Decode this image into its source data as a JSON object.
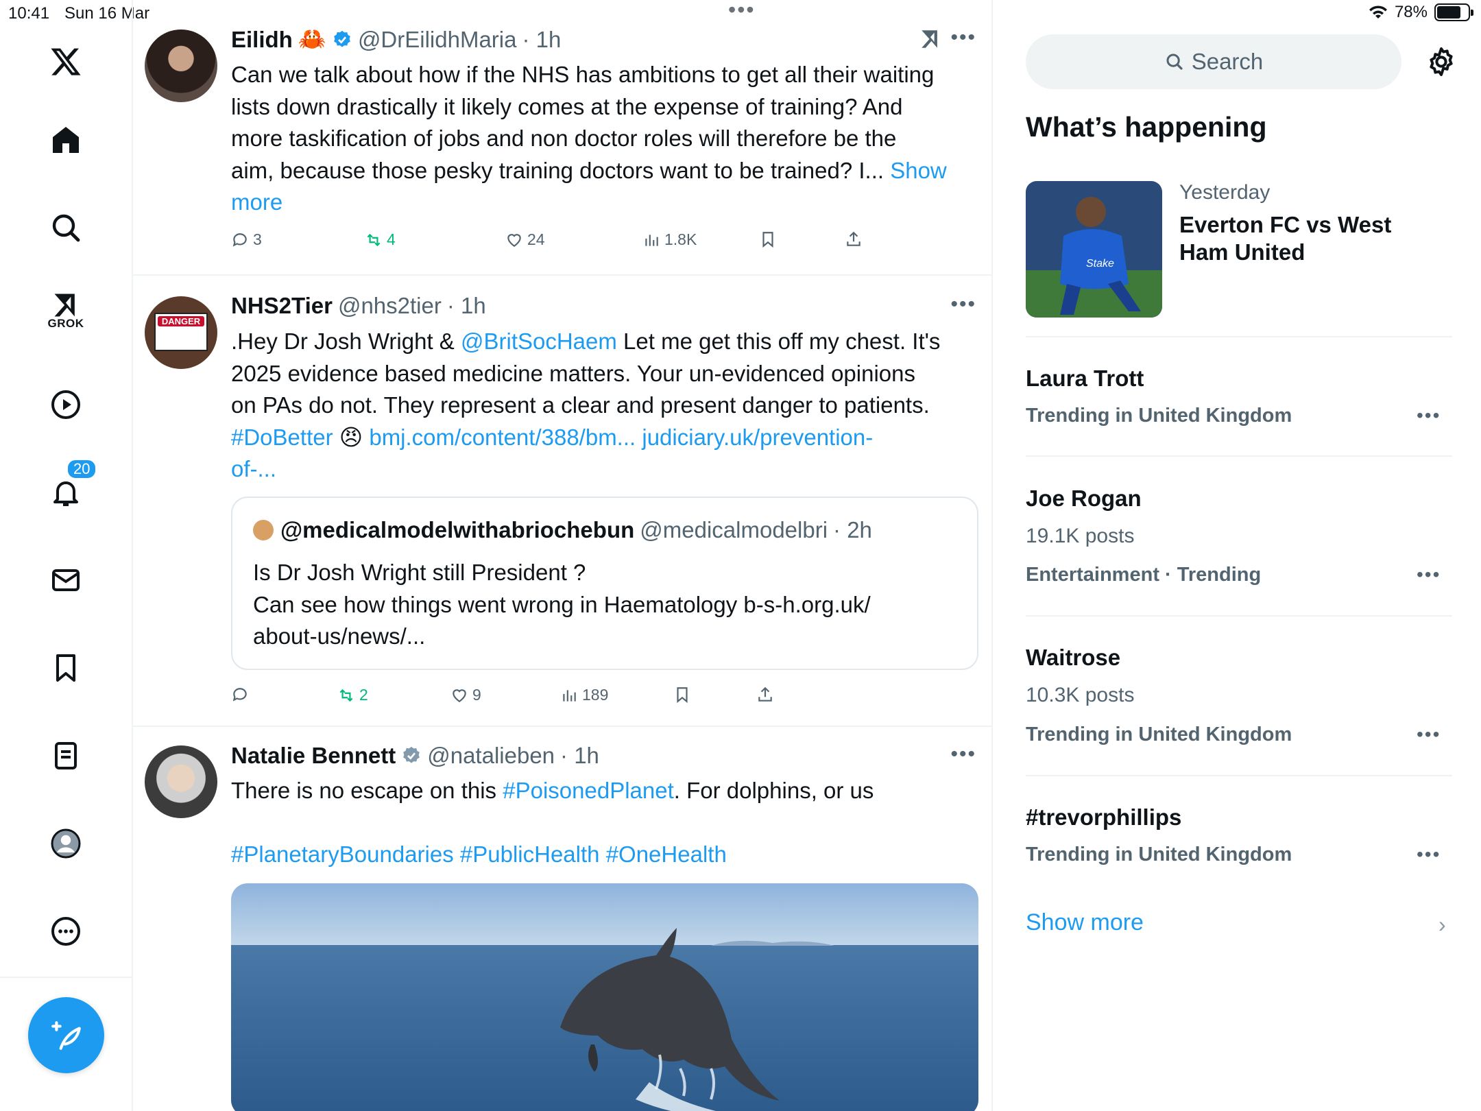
{
  "status_bar": {
    "time": "10:41",
    "date": "Sun 16 Mar",
    "battery": "78%",
    "battery_level": 0.78
  },
  "nav": {
    "notifications_badge": "20",
    "grok_label": "GROK",
    "items": [
      "x-logo",
      "home",
      "explore",
      "grok",
      "videos",
      "notifications",
      "messages",
      "bookmarks",
      "lists",
      "profile",
      "more"
    ]
  },
  "feed": {
    "tweets": [
      {
        "name": "Eilidh",
        "emoji": "🦀",
        "verified": true,
        "handle": "@DrEilidhMaria",
        "time": "· 1h",
        "body_lines": [
          "Can we talk about how if the NHS has ambitions to get all their waiting",
          "lists down drastically it likely comes at the expense of training? And",
          "more taskification of jobs and non doctor roles will therefore be the",
          "aim, because those pesky training doctors want to be trained? I... "
        ],
        "show_more": "Show",
        "show_more_2": "more",
        "replies": "3",
        "reposts": "4",
        "likes": "24",
        "views": "1.8K"
      },
      {
        "name": "NHS2Tier",
        "handle": "@nhs2tier",
        "time": "· 1h",
        "avatar_sign": "DANGER",
        "body_1a": ".Hey Dr Josh Wright & ",
        "body_1_link": "@BritSocHaem",
        "body_1b": " Let me get this off my chest. It's",
        "body_2": "2025 evidence based medicine matters. Your un-evidenced opinions",
        "body_3": "on PAs do not. They represent a clear and present danger to patients.",
        "body_4_tag": "#DoBetter",
        "body_4_emoji": "😠",
        "body_4_link1": "bmj.com/content/388/bm...",
        "body_4_link2": "judiciary.uk/prevention-",
        "body_5_link": "of-...",
        "quote": {
          "name": "@medicalmodelwithabriochebun",
          "handle": "@medicalmodelbri",
          "time": "· 2h",
          "line1": "Is Dr Josh Wright still President ?",
          "line2": "Can see how things went wrong in Haematology b-s-h.org.uk/",
          "line3": "about-us/news/..."
        },
        "replies": "",
        "reposts": "2",
        "likes": "9",
        "views": "189"
      },
      {
        "name": "Natalie Bennett",
        "verified": true,
        "handle": "@natalieben",
        "time": "· 1h",
        "body_1a": "There is no escape on this ",
        "body_1_tag": "#PoisonedPlanet",
        "body_1b": ". For dolphins, or us",
        "tags": [
          "#PlanetaryBoundaries",
          "#PublicHealth",
          "#OneHealth"
        ]
      }
    ]
  },
  "right": {
    "search_placeholder": "Search",
    "whats_happening": "What’s happening",
    "feature": {
      "meta": "Yesterday",
      "title": "Everton FC vs West Ham United"
    },
    "trends": [
      {
        "title": "Laura Trott",
        "sub": "",
        "meta": "Trending in United Kingdom"
      },
      {
        "title": "Joe Rogan",
        "sub": "19.1K posts",
        "meta": "Entertainment · Trending"
      },
      {
        "title": "Waitrose",
        "sub": "10.3K posts",
        "meta": "Trending in United Kingdom"
      },
      {
        "title": "#trevorphillips",
        "sub": "",
        "meta": "Trending in United Kingdom"
      }
    ],
    "show_more": "Show more",
    "colors": {
      "accent": "#1d9bf0",
      "repost": "#00ba7c",
      "muted": "#536471"
    }
  }
}
